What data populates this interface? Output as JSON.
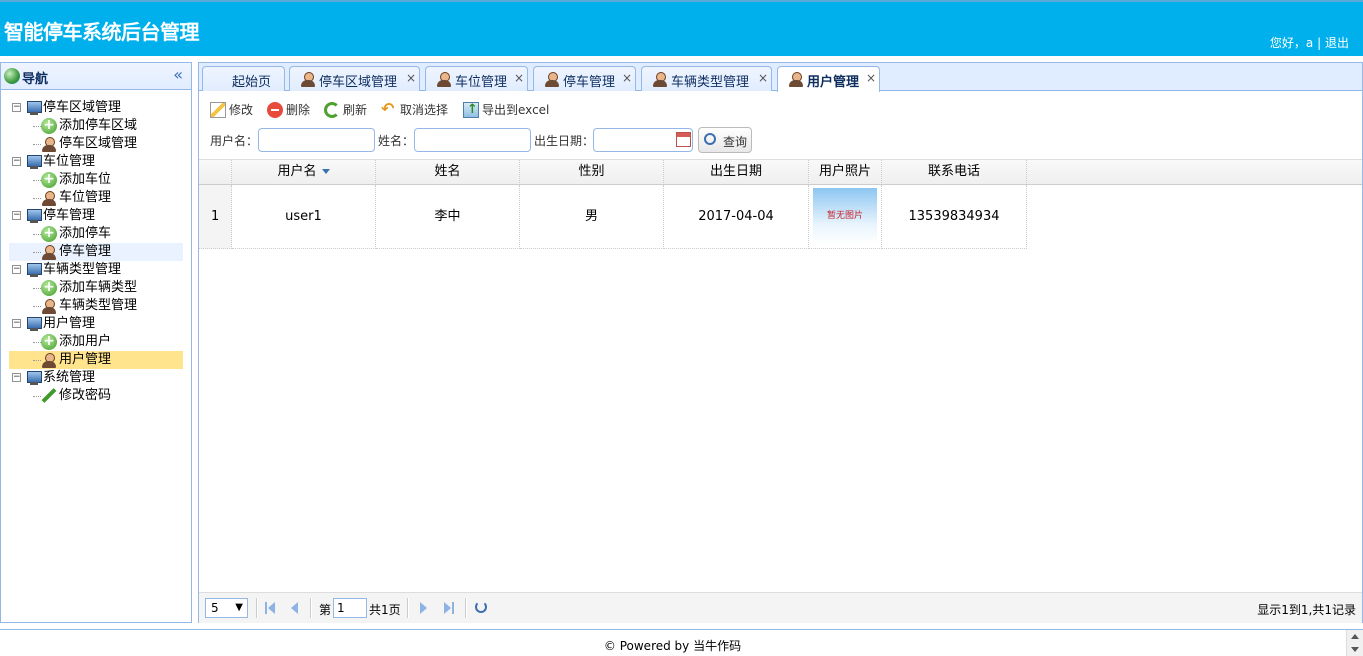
{
  "header": {
    "title": "智能停车系统后台管理",
    "greeting": "您好，a",
    "separator": "|",
    "logout": "退出"
  },
  "nav": {
    "title": "导航",
    "collapse_glyph": "«",
    "tree": [
      {
        "label": "停车区域管理",
        "children": [
          {
            "label": "添加停车区域",
            "icon": "add-icon"
          },
          {
            "label": "停车区域管理",
            "icon": "user-icon"
          }
        ]
      },
      {
        "label": "车位管理",
        "children": [
          {
            "label": "添加车位",
            "icon": "add-icon"
          },
          {
            "label": "车位管理",
            "icon": "user-icon"
          }
        ]
      },
      {
        "label": "停车管理",
        "children": [
          {
            "label": "添加停车",
            "icon": "add-icon"
          },
          {
            "label": "停车管理",
            "icon": "user-icon"
          }
        ]
      },
      {
        "label": "车辆类型管理",
        "children": [
          {
            "label": "添加车辆类型",
            "icon": "add-icon"
          },
          {
            "label": "车辆类型管理",
            "icon": "user-icon"
          }
        ]
      },
      {
        "label": "用户管理",
        "children": [
          {
            "label": "添加用户",
            "icon": "add-icon"
          },
          {
            "label": "用户管理",
            "icon": "user-icon",
            "selected": true
          }
        ]
      },
      {
        "label": "系统管理",
        "children": [
          {
            "label": "修改密码",
            "icon": "pencil-icon"
          }
        ]
      }
    ]
  },
  "tabs": [
    {
      "label": "起始页",
      "closable": false
    },
    {
      "label": "停车区域管理",
      "closable": true
    },
    {
      "label": "车位管理",
      "closable": true
    },
    {
      "label": "停车管理",
      "closable": true
    },
    {
      "label": "车辆类型管理",
      "closable": true
    },
    {
      "label": "用户管理",
      "closable": true,
      "active": true
    }
  ],
  "tab_close_glyph": "×",
  "toolbar": {
    "edit": "修改",
    "delete": "删除",
    "refresh": "刷新",
    "unselect": "取消选择",
    "export": "导出到excel"
  },
  "search": {
    "username_label": "用户名：",
    "username_value": "",
    "name_label": "姓名：",
    "name_value": "",
    "birth_label": "出生日期：",
    "birth_value": "",
    "query": "查询"
  },
  "grid": {
    "columns": [
      "用户名",
      "姓名",
      "性别",
      "出生日期",
      "用户照片",
      "联系电话"
    ],
    "sorted_column": "用户名",
    "rows": [
      {
        "row_number": "1",
        "username": "user1",
        "name": "李中",
        "gender": "男",
        "birth": "2017-04-04",
        "photo_text": "暂无图片",
        "phone": "13539834934"
      }
    ]
  },
  "pager": {
    "page_size": "5",
    "page_prefix": "第",
    "page_value": "1",
    "page_total": "共1页",
    "info": "显示1到1,共1记录"
  },
  "footer": {
    "text": "© Powered by 当牛作码"
  },
  "colors": {
    "header_bg": "#00b0ec",
    "border": "#95b8e7",
    "selected_row": "#ffe48d"
  }
}
